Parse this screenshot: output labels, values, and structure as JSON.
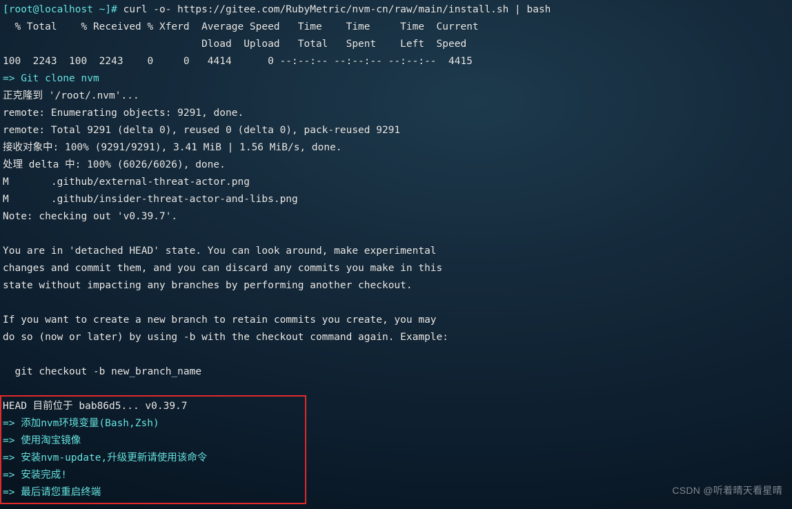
{
  "prompt": {
    "user": "[root@localhost ~]#",
    "cmd": " curl -o- https://gitee.com/RubyMetric/nvm-cn/raw/main/install.sh | bash"
  },
  "curl_header1": "  % Total    % Received % Xferd  Average Speed   Time    Time     Time  Current",
  "curl_header2": "                                 Dload  Upload   Total   Spent    Left  Speed",
  "curl_stats": "100  2243  100  2243    0     0   4414      0 --:--:-- --:--:-- --:--:--  4415",
  "git_clone": "=> Git clone nvm",
  "cloning": "正克隆到 '/root/.nvm'...",
  "remote1": "remote: Enumerating objects: 9291, done.",
  "remote2": "remote: Total 9291 (delta 0), reused 0 (delta 0), pack-reused 9291",
  "recv": "接收对象中: 100% (9291/9291), 3.41 MiB | 1.56 MiB/s, done.",
  "delta": "处理 delta 中: 100% (6026/6026), done.",
  "m1": "M       .github/external-threat-actor.png",
  "m2": "M       .github/insider-threat-actor-and-libs.png",
  "note": "Note: checking out 'v0.39.7'.",
  "detached1": "You are in 'detached HEAD' state. You can look around, make experimental",
  "detached2": "changes and commit them, and you can discard any commits you make in this",
  "detached3": "state without impacting any branches by performing another checkout.",
  "branch1": "If you want to create a new branch to retain commits you create, you may",
  "branch2": "do so (now or later) by using -b with the checkout command again. Example:",
  "example": "  git checkout -b new_branch_name",
  "head": "HEAD 目前位于 bab86d5... v0.39.7",
  "step1": "=> 添加nvm环境变量(Bash,Zsh)",
  "step2": "=> 使用淘宝镜像",
  "step3": "=> 安装nvm-update,升级更新请使用该命令",
  "step4": "=> 安装完成!",
  "step5": "=> 最后请您重启终端",
  "watermark": "CSDN @听着晴天看星晴"
}
